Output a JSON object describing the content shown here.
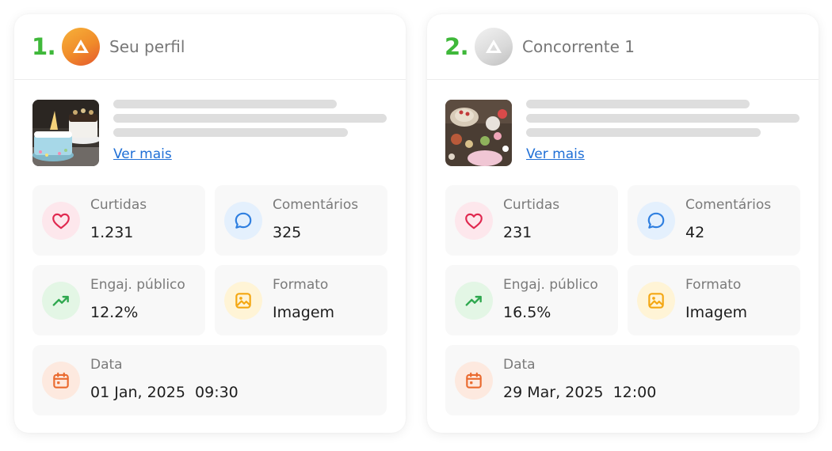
{
  "colors": {
    "rank": "#3fb83a",
    "link": "#1f6fd6",
    "heart": "#e0284f",
    "comment": "#2f7fe0",
    "trend": "#2fa84f",
    "image": "#f4a712",
    "calendar": "#ea6a2f"
  },
  "cards": [
    {
      "rank": "1.",
      "logo_icon": "brand-logo-orange-icon",
      "title": "Seu perfil",
      "thumbnail_icon": "cake-photo",
      "link_label": "Ver mais",
      "likes": {
        "label": "Curtidas",
        "value": "1.231",
        "icon": "heart-icon"
      },
      "comments": {
        "label": "Comentários",
        "value": "325",
        "icon": "chat-bubble-icon"
      },
      "engagement": {
        "label": "Engaj. público",
        "value": "12.2%",
        "icon": "trending-up-icon"
      },
      "format": {
        "label": "Formato",
        "value": "Imagem",
        "icon": "image-icon"
      },
      "date": {
        "label": "Data",
        "value": "01 Jan, 2025  09:30",
        "icon": "calendar-icon"
      }
    },
    {
      "rank": "2.",
      "logo_icon": "brand-logo-gray-icon",
      "title": "Concorrente 1",
      "thumbnail_icon": "party-table-photo",
      "link_label": "Ver mais",
      "likes": {
        "label": "Curtidas",
        "value": "231",
        "icon": "heart-icon"
      },
      "comments": {
        "label": "Comentários",
        "value": "42",
        "icon": "chat-bubble-icon"
      },
      "engagement": {
        "label": "Engaj. público",
        "value": "16.5%",
        "icon": "trending-up-icon"
      },
      "format": {
        "label": "Formato",
        "value": "Imagem",
        "icon": "image-icon"
      },
      "date": {
        "label": "Data",
        "value": "29 Mar, 2025  12:00",
        "icon": "calendar-icon"
      }
    }
  ]
}
